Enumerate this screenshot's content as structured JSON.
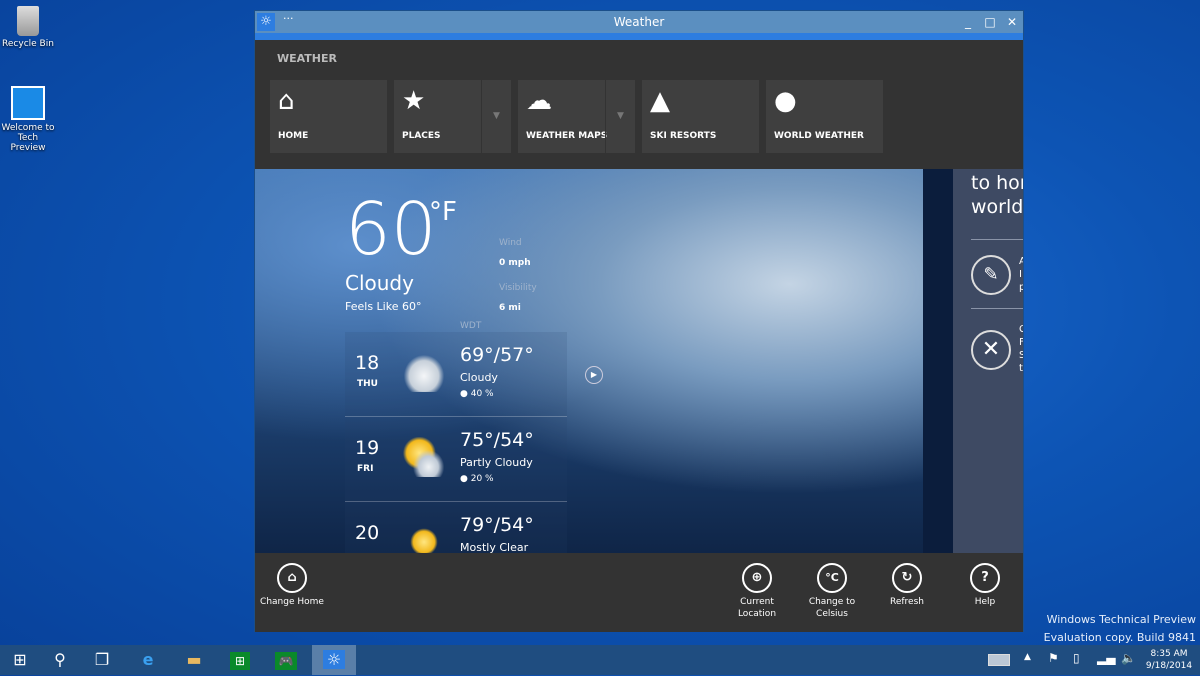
{
  "desktop": {
    "icons": [
      {
        "label": "Recycle Bin",
        "icon": "recycle-bin-icon"
      },
      {
        "label": "Welcome to Tech Preview",
        "icon": "windows-logo-icon"
      }
    ],
    "watermark": {
      "line1": "Windows Technical Preview",
      "line2": "Evaluation copy. Build 9841"
    }
  },
  "window": {
    "title": "Weather",
    "menu": "···",
    "minimize": "_",
    "maximize": "□",
    "close": "✕"
  },
  "nav": {
    "header": "WEATHER",
    "tiles": [
      {
        "label": "HOME",
        "icon": "home-icon",
        "glyph": "⌂"
      },
      {
        "label": "PLACES",
        "icon": "star-icon",
        "glyph": "★",
        "dropdown": true
      },
      {
        "label": "WEATHER MAPS",
        "icon": "weather-map-icon",
        "glyph": "☁",
        "dropdown": true
      },
      {
        "label": "SKI RESORTS",
        "icon": "mountain-icon",
        "glyph": "▲"
      },
      {
        "label": "WORLD WEATHER",
        "icon": "globe-icon",
        "glyph": "●"
      }
    ],
    "dropdown_glyph": "▼"
  },
  "current": {
    "temp": "60",
    "unit": "°F",
    "condition": "Cloudy",
    "feels_like": "Feels Like 60°",
    "wind_label": "Wind",
    "wind": "0 mph",
    "visibility_label": "Visibility",
    "visibility": "6 mi",
    "station": "WDT"
  },
  "forecast": [
    {
      "date": "18",
      "weekday": "THU",
      "hilo": "69°/57°",
      "condition": "Cloudy",
      "precip": "● 40 %",
      "icon": "cloud-icon"
    },
    {
      "date": "19",
      "weekday": "FRI",
      "hilo": "75°/54°",
      "condition": "Partly Cloudy",
      "precip": "● 20 %",
      "icon": "partly-cloudy-icon"
    },
    {
      "date": "20",
      "weekday": "",
      "hilo": "79°/54°",
      "condition": "Mostly Clear",
      "precip": "",
      "icon": "sun-icon"
    }
  ],
  "side_panel": {
    "text_line1": "to hor",
    "text_line2": "world",
    "item1": {
      "title": "A",
      "line1": "I",
      "line2": "p"
    },
    "item2": {
      "title": "C",
      "line1": "F",
      "line2": "S",
      "line3": "t"
    }
  },
  "appbar": {
    "change_home": "Change Home",
    "current_location": "Current Location",
    "change_celsius": "Change to Celsius",
    "celsius_glyph": "°C",
    "refresh": "Refresh",
    "refresh_glyph": "↻",
    "help": "Help",
    "help_glyph": "?"
  },
  "taskbar": {
    "time": "8:35 AM",
    "date": "9/18/2014"
  },
  "colors": {
    "accent": "#2d7de0",
    "titlebar": "#5b8fc0",
    "app_bg": "#333333",
    "panel": "#3e4a63"
  }
}
